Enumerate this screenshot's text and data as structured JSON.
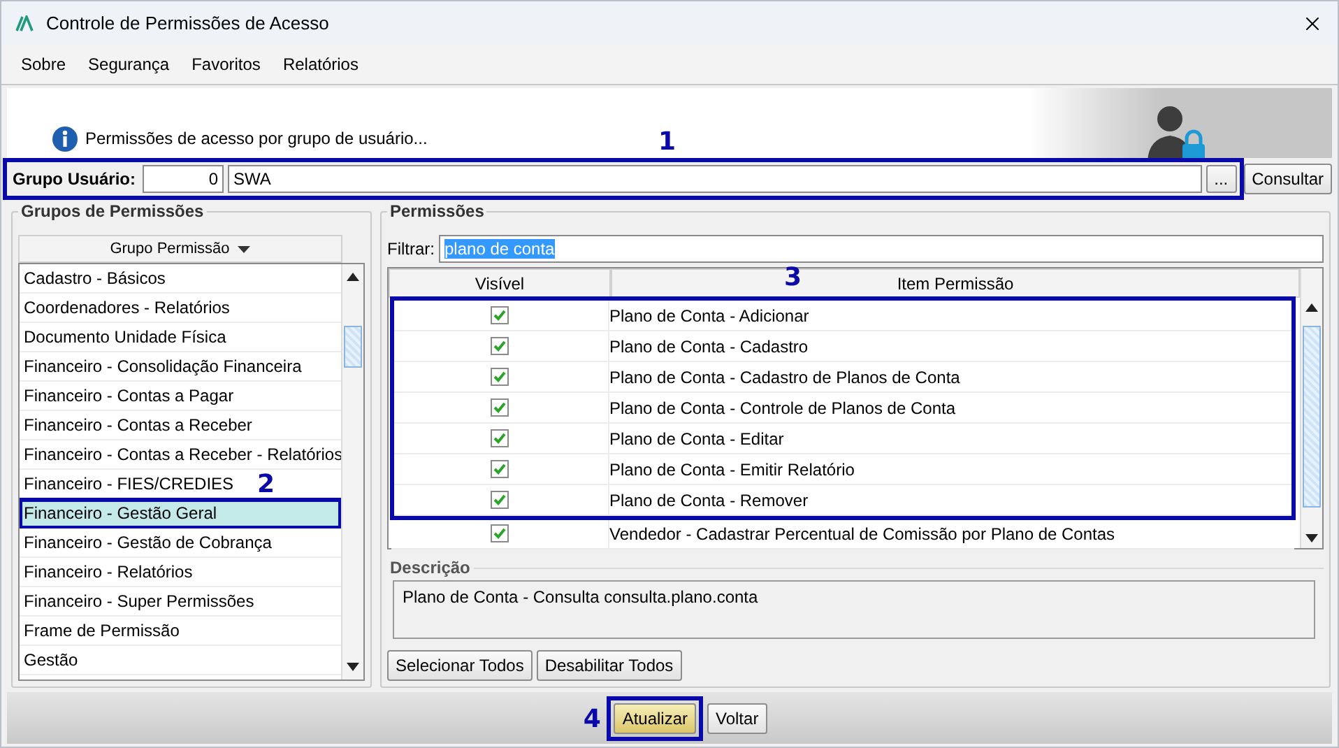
{
  "window": {
    "title": "Controle de Permissões de Acesso"
  },
  "menu": [
    {
      "label": "Sobre"
    },
    {
      "label": "Segurança"
    },
    {
      "label": "Favoritos"
    },
    {
      "label": "Relatórios"
    }
  ],
  "header": {
    "message": "Permissões de acesso por grupo de usuário..."
  },
  "group_user": {
    "label": "Grupo Usuário:",
    "code": "0",
    "name": "SWA",
    "browse_button": "...",
    "query_button": "Consultar",
    "callout": "1"
  },
  "permission_groups": {
    "legend": "Grupos de Permissões",
    "column": "Grupo Permissão",
    "callout": "2",
    "items": [
      {
        "label": "Cadastro - Básicos",
        "selected": false,
        "highlighted": false
      },
      {
        "label": "Coordenadores - Relatórios",
        "selected": false,
        "highlighted": false
      },
      {
        "label": "Documento Unidade Física",
        "selected": false,
        "highlighted": false
      },
      {
        "label": "Financeiro - Consolidação Financeira",
        "selected": false,
        "highlighted": false
      },
      {
        "label": "Financeiro - Contas a Pagar",
        "selected": false,
        "highlighted": false
      },
      {
        "label": "Financeiro - Contas a Receber",
        "selected": false,
        "highlighted": false
      },
      {
        "label": "Financeiro - Contas a Receber - Relatórios",
        "selected": false,
        "highlighted": false
      },
      {
        "label": "Financeiro - FIES/CREDIES",
        "selected": false,
        "highlighted": false
      },
      {
        "label": "Financeiro - Gestão Geral",
        "selected": true,
        "highlighted": true
      },
      {
        "label": "Financeiro - Gestão de Cobrança",
        "selected": false,
        "highlighted": false
      },
      {
        "label": "Financeiro - Relatórios",
        "selected": false,
        "highlighted": false
      },
      {
        "label": "Financeiro - Super Permissões",
        "selected": false,
        "highlighted": false
      },
      {
        "label": "Frame de Permissão",
        "selected": false,
        "highlighted": false
      },
      {
        "label": "Gestão",
        "selected": false,
        "highlighted": false
      }
    ]
  },
  "permissions": {
    "legend": "Permissões",
    "filter_label": "Filtrar:",
    "filter_value": "plano de conta",
    "filter_text_selected": true,
    "columns": [
      "Visível",
      "Item Permissão"
    ],
    "row_groups": [
      {
        "callout": "3",
        "rows": [
          {
            "visible": true,
            "item": "Plano de Conta - Adicionar"
          },
          {
            "visible": true,
            "item": "Plano de Conta - Cadastro"
          },
          {
            "visible": true,
            "item": "Plano de Conta - Cadastro de Planos de Conta"
          },
          {
            "visible": true,
            "item": "Plano de Conta - Controle de Planos de Conta"
          },
          {
            "visible": true,
            "item": "Plano de Conta - Editar"
          },
          {
            "visible": true,
            "item": "Plano de Conta - Emitir Relatório"
          },
          {
            "visible": true,
            "item": "Plano de Conta - Remover"
          }
        ]
      },
      {
        "rows": [
          {
            "visible": true,
            "item": "Vendedor - Cadastrar Percentual de Comissão por Plano de Contas"
          }
        ]
      }
    ],
    "description_legend": "Descrição",
    "description": "Plano de Conta - Consulta consulta.plano.conta",
    "buttons": [
      "Selecionar Todos",
      "Desabilitar Todos"
    ]
  },
  "footer": {
    "callout": "4",
    "buttons": [
      {
        "label": "Atualizar",
        "highlighted": true,
        "default": true
      },
      {
        "label": "Voltar",
        "highlighted": false,
        "default": false
      }
    ]
  }
}
